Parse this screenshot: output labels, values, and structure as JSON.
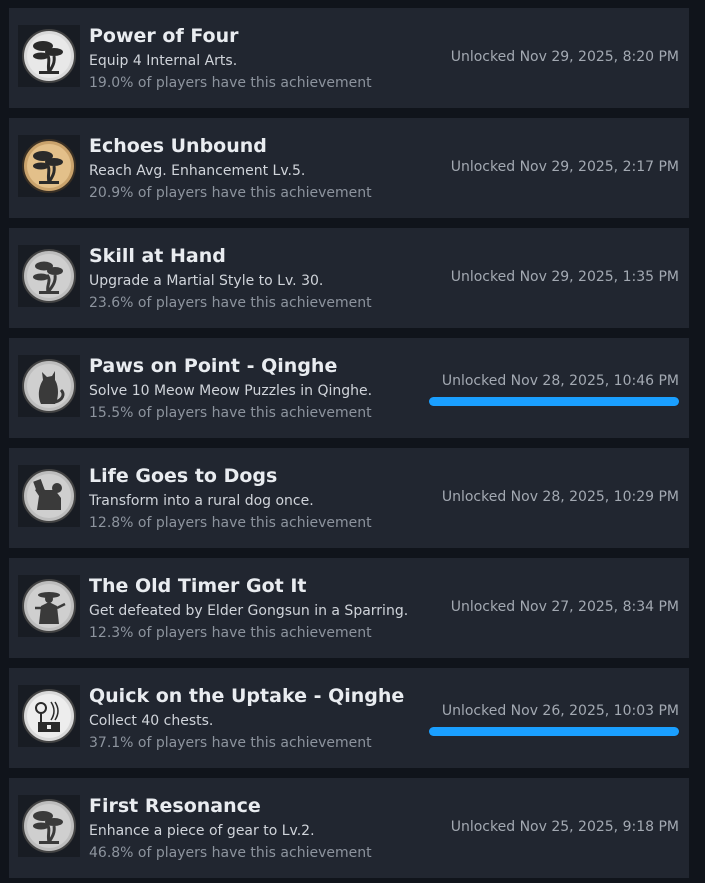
{
  "colors": {
    "page_bg": "#10141b",
    "row_bg": "#212630",
    "title": "#e9ecf0",
    "description": "#d0d4da",
    "muted": "#8d949e",
    "accent_bar": "#1a9fff",
    "gold_icon": "#d8b37a",
    "silver_icon": "#d9d9d9"
  },
  "achievements": [
    {
      "icon": "bonsai-tree-icon",
      "title": "Power of Four",
      "description": "Equip 4 Internal Arts.",
      "percent": "19.0% of players have this achievement",
      "unlocked": "Unlocked Nov 29, 2025, 8:20 PM"
    },
    {
      "icon": "golden-bonsai-tree-icon",
      "title": "Echoes Unbound",
      "description": "Reach Avg. Enhancement Lv.5.",
      "percent": "20.9% of players have this achievement",
      "unlocked": "Unlocked Nov 29, 2025, 2:17 PM"
    },
    {
      "icon": "bonsai-tree-icon",
      "title": "Skill at Hand",
      "description": "Upgrade a Martial Style to Lv. 30.",
      "percent": "23.6% of players have this achievement",
      "unlocked": "Unlocked Nov 29, 2025, 1:35 PM"
    },
    {
      "icon": "cat-icon",
      "title": "Paws on Point - Qinghe",
      "description": "Solve 10 Meow Meow Puzzles in Qinghe.",
      "percent": "15.5% of players have this achievement",
      "unlocked": "Unlocked Nov 28, 2025, 10:46 PM"
    },
    {
      "icon": "dog-icon",
      "title": "Life Goes to Dogs",
      "description": "Transform into a rural dog once.",
      "percent": "12.8% of players have this achievement",
      "unlocked": "Unlocked Nov 28, 2025, 10:29 PM"
    },
    {
      "icon": "elder-figure-icon",
      "title": "The Old Timer Got It",
      "description": "Get defeated by Elder Gongsun in a Sparring.",
      "percent": "12.3% of players have this achievement",
      "unlocked": "Unlocked Nov 27, 2025, 8:34 PM"
    },
    {
      "icon": "chest-flower-icon",
      "title": "Quick on the Uptake - Qinghe",
      "description": "Collect 40 chests.",
      "percent": "37.1% of players have this achievement",
      "unlocked": "Unlocked Nov 26, 2025, 10:03 PM"
    },
    {
      "icon": "bonsai-tree-icon",
      "title": "First Resonance",
      "description": "Enhance a piece of gear to Lv.2.",
      "percent": "46.8% of players have this achievement",
      "unlocked": "Unlocked Nov 25, 2025, 9:18 PM"
    }
  ]
}
